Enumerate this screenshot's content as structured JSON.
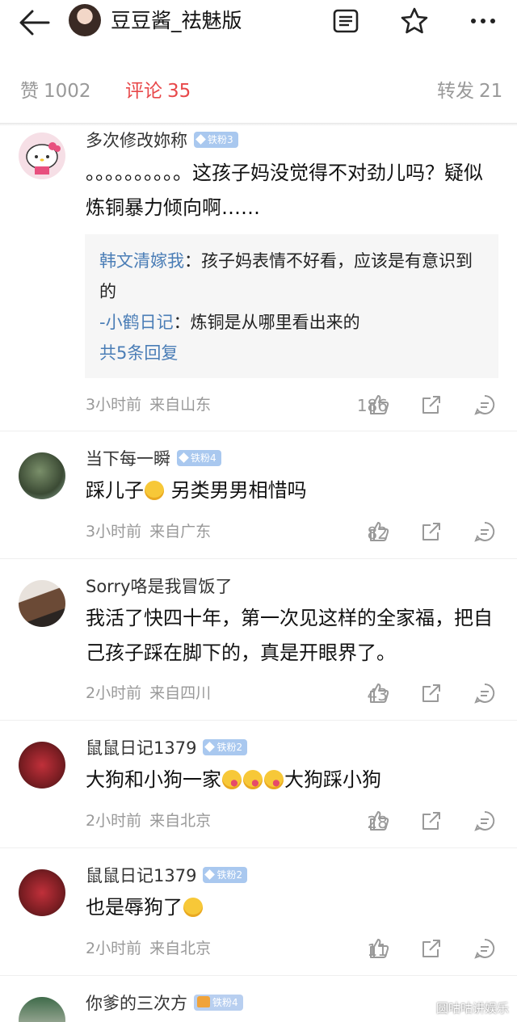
{
  "header": {
    "title": "豆豆酱_祛魅版",
    "icons": [
      "back-arrow-icon",
      "notes-icon",
      "star-icon",
      "more-icon"
    ]
  },
  "tabs": [
    {
      "label": "赞",
      "count": "1002"
    },
    {
      "label": "评论",
      "count": "35"
    },
    {
      "label": "转发",
      "count": "21"
    }
  ],
  "comments": [
    {
      "name": "多次修改妳称",
      "badge": "铁粉3",
      "text": "。。。。。。。。。。这孩子妈没觉得不对劲儿吗？疑似炼铜暴力倾向啊……",
      "replies": [
        {
          "name": "韩文清嫁我",
          "text": "：孩子妈表情不好看，应该是有意识到的"
        },
        {
          "name": "-小鹤日记",
          "text": "：炼铜是从哪里看出来的"
        }
      ],
      "more_replies": "共5条回复",
      "time": "3小时前",
      "location": "来自山东",
      "likes": "186"
    },
    {
      "name": "当下每一瞬",
      "badge": "铁粉4",
      "text_before": "踩儿子",
      "text_after": " 另类男男相惜吗",
      "time": "3小时前",
      "location": "来自广东",
      "likes": "82"
    },
    {
      "name": "Sorry咯是我冒饭了",
      "text": "我活了快四十年，第一次见这样的全家福，把自己孩子踩在脚下的，真是开眼界了。",
      "time": "2小时前",
      "location": "来自四川",
      "likes": "43"
    },
    {
      "name": "鼠鼠日记1379",
      "badge": "铁粉2",
      "text_before": "大狗和小狗一家",
      "text_after": "大狗踩小狗",
      "time": "2小时前",
      "location": "来自北京",
      "likes": "28"
    },
    {
      "name": "鼠鼠日记1379",
      "badge": "铁粉2",
      "text_before": "也是辱狗了",
      "time": "2小时前",
      "location": "来自北京",
      "likes": "11"
    },
    {
      "name": "你爹的三次方",
      "badge": "铁粉4"
    }
  ],
  "watermark": "圆咕咕讲娱乐",
  "colors": {
    "accent": "#e8484a",
    "reply_name": "#4a7db6",
    "meta": "#999999",
    "badge": "#a9c8ef"
  }
}
